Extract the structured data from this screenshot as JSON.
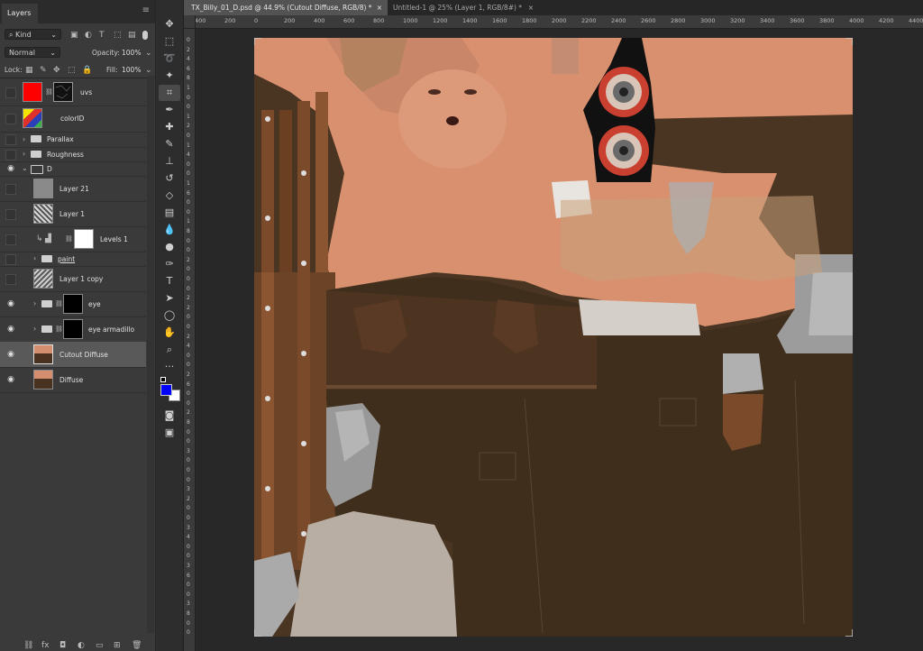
{
  "layers_panel": {
    "tab_label": "Layers",
    "filter_kind": "Kind",
    "blend_mode": "Normal",
    "opacity_label": "Opacity:",
    "opacity_value": "100%",
    "lock_label": "Lock:",
    "fill_label": "Fill:",
    "fill_value": "100%",
    "layers": [
      {
        "name": "uvs"
      },
      {
        "name": "colorID"
      },
      {
        "name": "Parallax"
      },
      {
        "name": "Roughness"
      },
      {
        "name": "D"
      },
      {
        "name": "Layer 21"
      },
      {
        "name": "Layer 1"
      },
      {
        "name": "Levels 1"
      },
      {
        "name": "paint"
      },
      {
        "name": "Layer 1 copy"
      },
      {
        "name": "eye"
      },
      {
        "name": "eye armadillo"
      },
      {
        "name": "Cutout Diffuse"
      },
      {
        "name": "Diffuse"
      }
    ]
  },
  "document": {
    "tabs": [
      {
        "label": "TX_Billy_01_D.psd @ 44.9% (Cutout Diffuse, RGB/8) *"
      },
      {
        "label": "Untitled-1 @ 25% (Layer 1, RGB/8#) *"
      }
    ],
    "ruler_top": [
      "400",
      "200",
      "0",
      "200",
      "400",
      "600",
      "800",
      "1000",
      "1200",
      "1400",
      "1600",
      "1800",
      "2000",
      "2200",
      "2400",
      "2600",
      "2800",
      "3000",
      "3200",
      "3400",
      "3600",
      "3800",
      "4000",
      "4200",
      "4400"
    ],
    "ruler_left": [
      "0",
      "2",
      "4",
      "6",
      "8",
      "1",
      "0",
      "0",
      "1",
      "2",
      "0",
      "1",
      "4",
      "0",
      "0",
      "1",
      "6",
      "0",
      "0",
      "1",
      "8",
      "0",
      "0",
      "2",
      "0",
      "0",
      "0",
      "2",
      "2",
      "0",
      "0",
      "2",
      "4",
      "0",
      "0",
      "2",
      "6",
      "0",
      "0",
      "2",
      "8",
      "0",
      "0",
      "3",
      "0",
      "0",
      "0",
      "3",
      "2",
      "0",
      "0",
      "3",
      "4",
      "0",
      "0",
      "3",
      "6",
      "0",
      "0",
      "3",
      "8",
      "0",
      "0"
    ]
  },
  "colors": {
    "foreground": "#0000ff",
    "background": "#ffffff",
    "uvs_thumb": "#ff0000"
  }
}
